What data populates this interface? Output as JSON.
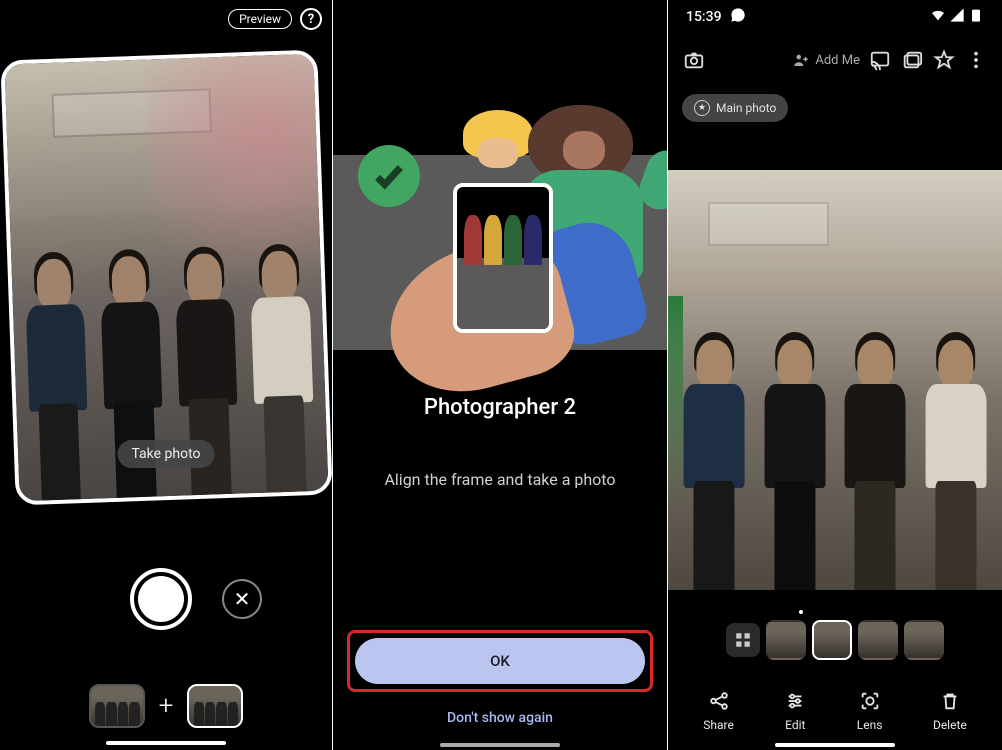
{
  "panel1": {
    "preview_label": "Preview",
    "hint_text": "Take photo"
  },
  "panel2": {
    "title": "Photographer 2",
    "subtitle": "Align the frame and take a photo",
    "ok_label": "OK",
    "dont_show_label": "Don't show again"
  },
  "panel3": {
    "status_time": "15:39",
    "addme_label": "Add Me",
    "main_photo_label": "Main photo",
    "actions": {
      "share": "Share",
      "edit": "Edit",
      "lens": "Lens",
      "delete": "Delete"
    }
  }
}
